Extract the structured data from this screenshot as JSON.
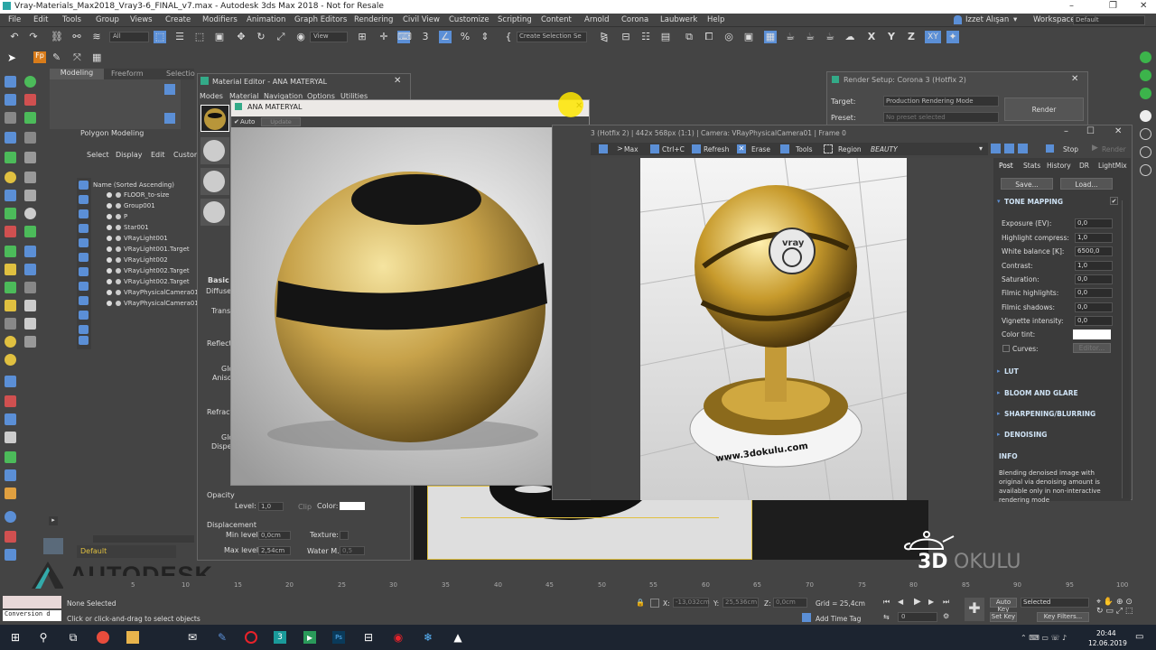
{
  "window": {
    "title": "Vray-Materials_Max2018_Vray3-6_FINAL_v7.max - Autodesk 3ds Max 2018 - Not for Resale",
    "min": "–",
    "max": "❐",
    "close": "✕"
  },
  "menu": {
    "items": [
      "File",
      "Edit",
      "Tools",
      "Group",
      "Views",
      "Create",
      "Modifiers",
      "Animation",
      "Graph Editors",
      "Rendering",
      "Civil View",
      "Customize",
      "Scripting",
      "Content",
      "Arnold",
      "Corona",
      "Laubwerk",
      "Help"
    ],
    "user": "Izzet Alışan",
    "workspaces_label": "Workspaces:",
    "workspaces_value": "Default"
  },
  "toolbar": {
    "filter_all": "All",
    "view": "View",
    "create_selection_set": "Create Selection Se",
    "axes": [
      "X",
      "Y",
      "Z",
      "XY"
    ]
  },
  "ribbon": {
    "tabs": [
      "Modeling",
      "Freeform",
      "Selectio"
    ],
    "polygon_modeling": "Polygon Modeling"
  },
  "scene_explorer": {
    "tabs": [
      "Select",
      "Display",
      "Edit",
      "Custom"
    ],
    "header": "Name (Sorted Ascending)",
    "items": [
      "FLOOR_to-size",
      "Group001",
      "P",
      "Star001",
      "VRayLight001",
      "VRayLight001.Target",
      "VRayLight002",
      "VRayLight002.Target",
      "VRayLight002.Target",
      "VRayPhysicalCamera01",
      "VRayPhysicalCamera01."
    ],
    "layer": "Default"
  },
  "material_editor": {
    "title": "Material Editor - ANA MATERYAL",
    "menu": [
      "Modes",
      "Material",
      "Navigation",
      "Options",
      "Utilities"
    ],
    "sections": {
      "basic": "Basic",
      "diffuse": "Diffuse",
      "transl": "Transl",
      "reflection": "Reflectio",
      "glossiness": "Glo",
      "aniso": "Aniso",
      "refraction": "Refracti",
      "gloss2": "Glo",
      "dispersion": "Disper",
      "opacity": "Opacity",
      "level_label": "Level:",
      "level_value": "1,0",
      "clip": "Clip",
      "color_label": "Color:",
      "displacement": "Displacement",
      "min_level_label": "Min level:",
      "min_level_value": "0,0cm",
      "texture_label": "Texture:",
      "max_level_label": "Max level:",
      "max_level_value": "2,54cm",
      "water_label": "Water M.:",
      "water_value": "0,5"
    }
  },
  "active_material": {
    "title": "ANA MATERYAL",
    "auto": "Auto",
    "update": "Update"
  },
  "render_setup": {
    "title": "Render Setup: Corona 3 (Hotfix 2)",
    "target_label": "Target:",
    "target_value": "Production Rendering Mode",
    "preset_label": "Preset:",
    "preset_value": "No preset selected",
    "render_button": "Render"
  },
  "vfb": {
    "title": "3 (Hotfix 2) | 442x 568px (1:1) | Camera: VRayPhysicalCamera01 | Frame 0",
    "toolbar": [
      "Max",
      "Ctrl+C",
      "Refresh",
      "Erase",
      "Tools",
      "Region"
    ],
    "pass": "BEAUTY",
    "stop": "Stop",
    "render": "Render",
    "tabs": [
      "Post",
      "Stats",
      "History",
      "DR",
      "LightMix"
    ],
    "save": "Save...",
    "load": "Load...",
    "tone_mapping": "TONE MAPPING",
    "rows": [
      {
        "label": "Exposure (EV):",
        "value": "0,0"
      },
      {
        "label": "Highlight compress:",
        "value": "1,0"
      },
      {
        "label": "White balance [K]:",
        "value": "6500,0"
      },
      {
        "label": "Contrast:",
        "value": "1,0"
      },
      {
        "label": "Saturation:",
        "value": "0,0"
      },
      {
        "label": "Filmic highlights:",
        "value": "0,0"
      },
      {
        "label": "Filmic shadows:",
        "value": "0,0"
      },
      {
        "label": "Vignette intensity:",
        "value": "0,0"
      }
    ],
    "color_tint": "Color tint:",
    "curves": "Curves:",
    "editor": "Editor...",
    "lut": "LUT",
    "bloom": "BLOOM AND GLARE",
    "sharpen": "SHARPENING/BLURRING",
    "denoising": "DENOISING",
    "info": "INFO",
    "info_text": "Blending denoised image with original via denoising amount is available only in non-interactive rendering mode",
    "render_text_top": "vray",
    "render_text_base": "www.3dokulu.com"
  },
  "brand": {
    "autodesk": "AUTODESK",
    "logo_3d": "3D",
    "logo_okulu": "OKULU"
  },
  "timeline": {
    "ticks": [
      "5",
      "10",
      "15",
      "20",
      "25",
      "30",
      "35",
      "40",
      "45",
      "50",
      "55",
      "60",
      "65",
      "70",
      "75",
      "80",
      "85",
      "90",
      "95",
      "100"
    ]
  },
  "status": {
    "conversion": "Conversion d",
    "none_selected": "None Selected",
    "hint": "Click or click-and-drag to select objects",
    "x_label": "X:",
    "x_value": "-13,032cm",
    "y_label": "Y:",
    "y_value": "25,536cm",
    "z_label": "Z:",
    "z_value": "0,0cm",
    "grid": "Grid = 25,4cm",
    "add_time_tag": "Add Time Tag",
    "auto_key": "Auto Key",
    "selected": "Selected",
    "set_key": "Set Key",
    "key_filters": "Key Filters...",
    "frame": "0"
  },
  "taskbar": {
    "time": "20:44",
    "date": "12.06.2019"
  },
  "colors": {
    "accent_blue": "#4a90d9",
    "gold": "#c9a545"
  }
}
